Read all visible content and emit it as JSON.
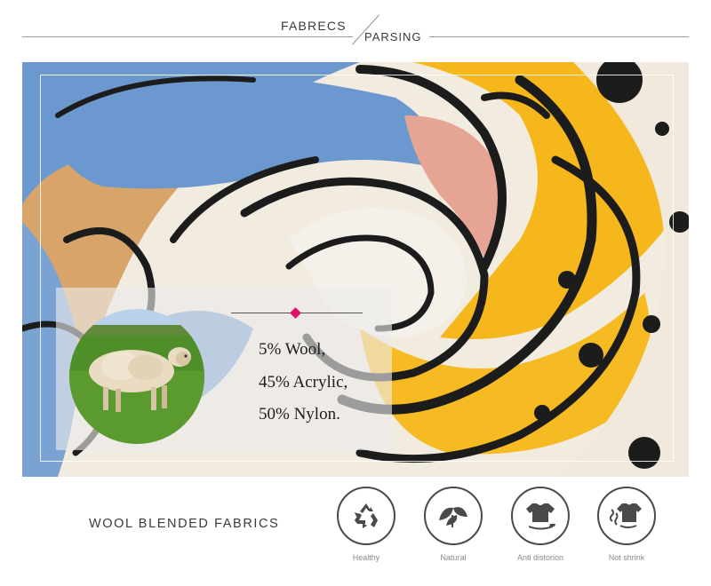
{
  "header": {
    "word1": "FABRECS",
    "word2": "PARSING"
  },
  "composition": [
    {
      "label": "5% Wool,"
    },
    {
      "label": "45% Acrylic,"
    },
    {
      "label": "50% Nylon."
    }
  ],
  "tagline": "WOOL BLENDED FABRICS",
  "features": [
    {
      "label": "Healthy",
      "icon": "recycle-icon"
    },
    {
      "label": "Natural",
      "icon": "leaves-icon"
    },
    {
      "label": "Anti distorion",
      "icon": "shirt-iron-icon"
    },
    {
      "label": "Not shrink",
      "icon": "shirt-dryer-icon"
    }
  ],
  "colors": {
    "accent_diamond": "#e0116b",
    "fabric_yellow": "#f6b81a",
    "fabric_blue": "#6a98cf",
    "fabric_tan": "#d9a56b",
    "fabric_pink": "#e5a494",
    "fabric_cream": "#f3ede2",
    "fabric_black": "#1c1c1c",
    "grass_green": "#4f8f2a"
  }
}
